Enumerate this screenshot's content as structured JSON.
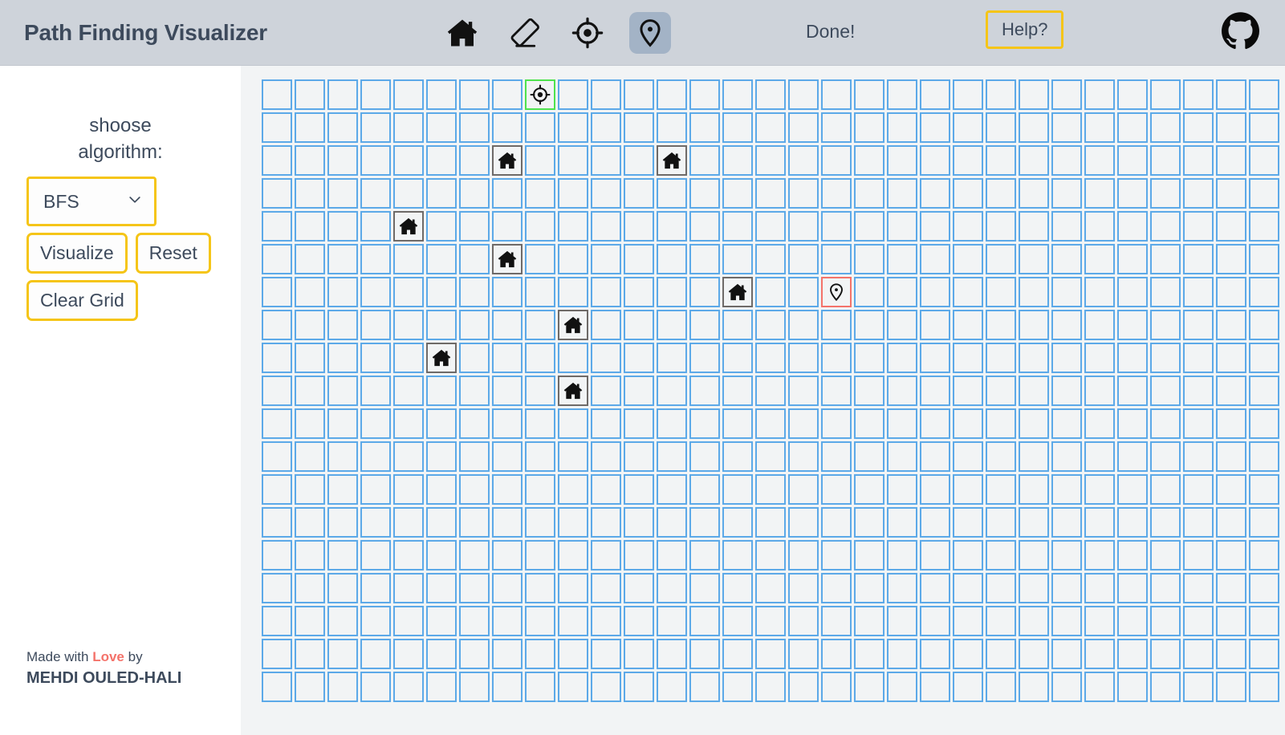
{
  "header": {
    "title": "Path Finding Visualizer",
    "status": "Done!",
    "help_label": "Help?",
    "github_icon": "github-icon",
    "tools": [
      {
        "name": "wall-tool",
        "icon": "house-icon",
        "selected": false
      },
      {
        "name": "erase-tool",
        "icon": "eraser-icon",
        "selected": false
      },
      {
        "name": "start-tool",
        "icon": "crosshair-icon",
        "selected": false
      },
      {
        "name": "end-tool",
        "icon": "map-pin-icon",
        "selected": true
      }
    ]
  },
  "sidebar": {
    "algorithm_label": "shoose algorithm:",
    "algorithm_selected": "BFS",
    "algorithm_options": [
      "BFS"
    ],
    "chevron_icon": "chevron-down-icon",
    "buttons": [
      {
        "name": "visualize-button",
        "label": "Visualize"
      },
      {
        "name": "reset-button",
        "label": "Reset"
      },
      {
        "name": "clear-grid-button",
        "label": "Clear Grid"
      }
    ],
    "credit_prefix": "Made with ",
    "credit_love": "Love",
    "credit_suffix": " by",
    "credit_author": "MEHDI OULED-HALI"
  },
  "grid": {
    "columns": 31,
    "rows": 19,
    "cell_size": 38,
    "gap": 3,
    "start": {
      "row": 0,
      "col": 8,
      "icon": "crosshair-icon"
    },
    "end": {
      "row": 6,
      "col": 17,
      "icon": "map-pin-icon"
    },
    "walls": [
      {
        "row": 2,
        "col": 7
      },
      {
        "row": 2,
        "col": 12
      },
      {
        "row": 4,
        "col": 4
      },
      {
        "row": 5,
        "col": 7
      },
      {
        "row": 6,
        "col": 14
      },
      {
        "row": 7,
        "col": 9
      },
      {
        "row": 8,
        "col": 5
      },
      {
        "row": 9,
        "col": 9
      }
    ],
    "wall_icon": "house-icon"
  },
  "colors": {
    "header_bg": "#ced3da",
    "accent_yellow": "#f5c518",
    "text_dark": "#3d4a5c",
    "cell_border": "#5ca9e8",
    "start_border": "#4ee34e",
    "end_border": "#f4736a",
    "wall_border": "#6e6a68",
    "love_red": "#f4726a",
    "grid_bg": "#f2f4f5",
    "tool_selected_bg": "#a3b3c6"
  }
}
